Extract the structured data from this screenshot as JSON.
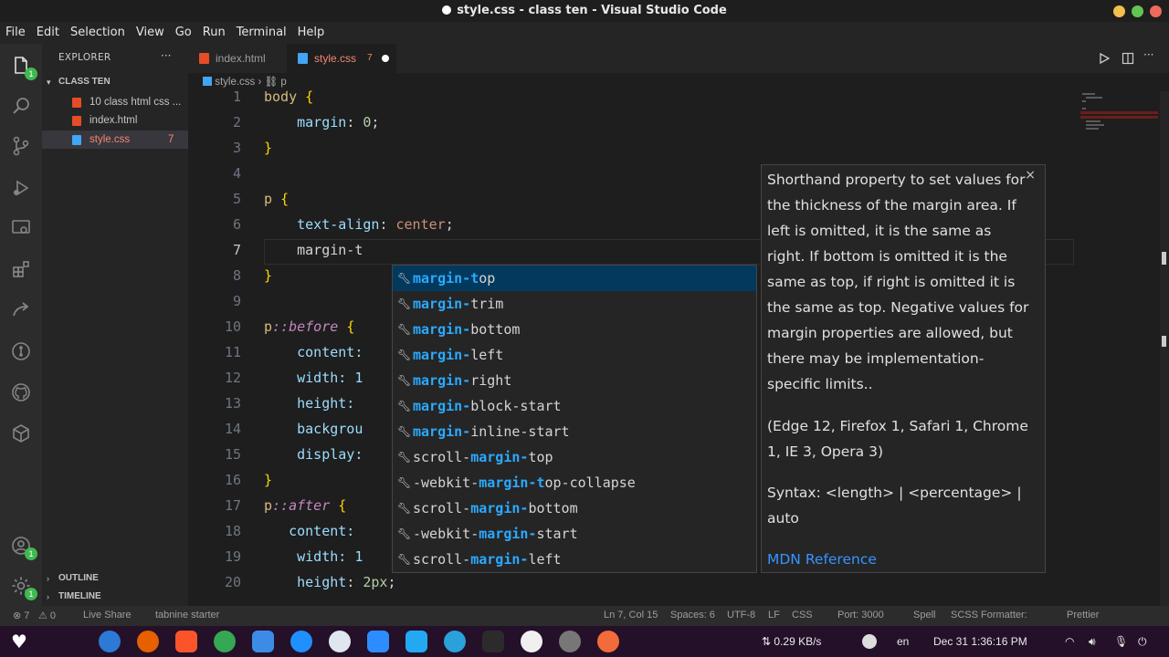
{
  "window": {
    "title": "style.css - class ten - Visual Studio Code"
  },
  "menu": [
    "File",
    "Edit",
    "Selection",
    "View",
    "Go",
    "Run",
    "Terminal",
    "Help"
  ],
  "sidebar": {
    "header": "EXPLORER",
    "more": "···",
    "folder": "CLASS TEN",
    "items": [
      {
        "label": "10 class html css ...",
        "badge": ""
      },
      {
        "label": "index.html",
        "badge": ""
      },
      {
        "label": "style.css",
        "badge": "7"
      }
    ],
    "outline": "OUTLINE",
    "timeline": "TIMELINE"
  },
  "tabs": [
    {
      "label": "index.html",
      "badge": ""
    },
    {
      "label": "style.css",
      "badge": "7"
    }
  ],
  "breadcrumb": {
    "file": "style.css",
    "symbol": "p"
  },
  "editor": {
    "lines": [
      {
        "n": "1",
        "text": "body {"
      },
      {
        "n": "2",
        "text": "    margin: 0;"
      },
      {
        "n": "3",
        "text": "}"
      },
      {
        "n": "4",
        "text": ""
      },
      {
        "n": "5",
        "text": "p {"
      },
      {
        "n": "6",
        "text": "    text-align: center;"
      },
      {
        "n": "7",
        "text": "    margin-t"
      },
      {
        "n": "8",
        "text": "}"
      },
      {
        "n": "9",
        "text": ""
      },
      {
        "n": "10",
        "text": "p::before {"
      },
      {
        "n": "11",
        "text": "    content:"
      },
      {
        "n": "12",
        "text": "    width: 1"
      },
      {
        "n": "13",
        "text": "    height:"
      },
      {
        "n": "14",
        "text": "    backgrou"
      },
      {
        "n": "15",
        "text": "    display:"
      },
      {
        "n": "16",
        "text": "}"
      },
      {
        "n": "17",
        "text": "p::after {"
      },
      {
        "n": "18",
        "text": "   content:"
      },
      {
        "n": "19",
        "text": "    width: 1"
      },
      {
        "n": "20",
        "text": "    height: 2px;"
      }
    ]
  },
  "suggestions": [
    {
      "match": "margin-t",
      "rest": "op",
      "pre": ""
    },
    {
      "match": "margin-",
      "rest": "trim",
      "pre": ""
    },
    {
      "match": "margin-",
      "rest": "bottom",
      "pre": ""
    },
    {
      "match": "margin-",
      "rest": "left",
      "pre": ""
    },
    {
      "match": "margin-",
      "rest": "right",
      "pre": ""
    },
    {
      "match": "margin-",
      "rest": "block-start",
      "pre": ""
    },
    {
      "match": "margin-",
      "rest": "inline-start",
      "pre": ""
    },
    {
      "match": "margin-",
      "rest": "top",
      "pre": "scroll-"
    },
    {
      "match": "margin-t",
      "rest": "op-collapse",
      "pre": "-webkit-"
    },
    {
      "match": "margin-",
      "rest": "bottom",
      "pre": "scroll-"
    },
    {
      "match": "margin-",
      "rest": "start",
      "pre": "-webkit-"
    },
    {
      "match": "margin-",
      "rest": "left",
      "pre": "scroll-"
    }
  ],
  "docs": {
    "description": "Shorthand property to set values for the thickness of the margin area. If left is omitted, it is the same as right. If bottom is omitted it is the same as top, if right is omitted it is the same as top. Negative values for margin properties are allowed, but there may be implementation-specific limits..",
    "browsers": "(Edge 12, Firefox 1, Safari 1, Chrome 1, IE 3, Opera 3)",
    "syntax": "Syntax: <length> | <percentage> | auto",
    "link": "MDN Reference",
    "close": "×"
  },
  "status": {
    "errors": "⊗ 7",
    "warnings": "⚠ 0",
    "liveshare": "Live Share",
    "tabnine": "tabnine starter",
    "position": "Ln 7, Col 15",
    "spaces": "Spaces: 6",
    "encoding": "UTF-8",
    "eol": "LF",
    "language": "CSS",
    "port": "Port: 3000",
    "spell": "Spell",
    "formatter": "SCSS Formatter:",
    "prettier": "Prettier"
  },
  "taskbar": {
    "network": "⇅ 0.29 KB/s",
    "lang": "en",
    "datetime": "Dec 31  1:36:16 PM"
  }
}
